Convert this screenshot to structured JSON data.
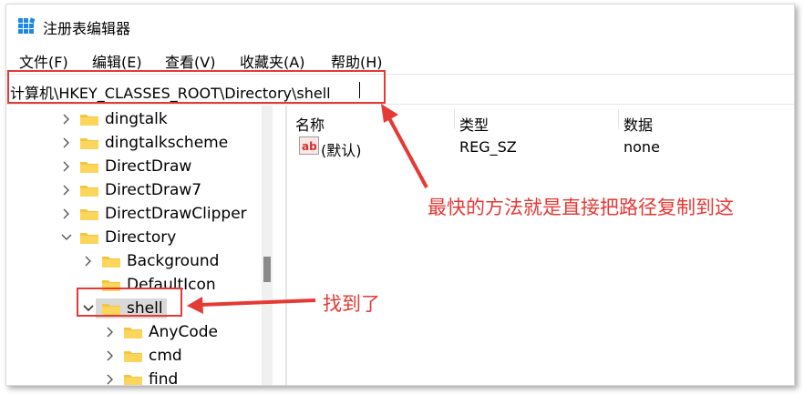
{
  "window": {
    "title": "注册表编辑器",
    "icon": "regedit-icon"
  },
  "menu": [
    "文件(F)",
    "编辑(E)",
    "查看(V)",
    "收藏夹(A)",
    "帮助(H)"
  ],
  "address": {
    "path": "计算机\\HKEY_CLASSES_ROOT\\Directory\\shell"
  },
  "tree": {
    "items": [
      {
        "label": "dingtalk",
        "expanded": false
      },
      {
        "label": "dingtalkscheme",
        "expanded": false
      },
      {
        "label": "DirectDraw",
        "expanded": false
      },
      {
        "label": "DirectDraw7",
        "expanded": false
      },
      {
        "label": "DirectDrawClipper",
        "expanded": false
      },
      {
        "label": "Directory",
        "expanded": true
      },
      {
        "label": "Background",
        "expanded": false
      },
      {
        "label": "DefaultIcon",
        "expanded": null
      },
      {
        "label": "shell",
        "expanded": true,
        "selected": true
      },
      {
        "label": "AnyCode",
        "expanded": false
      },
      {
        "label": "cmd",
        "expanded": false
      },
      {
        "label": "find",
        "expanded": false
      }
    ]
  },
  "list": {
    "columns": [
      "名称",
      "类型",
      "数据"
    ],
    "rows": [
      {
        "name": "(默认)",
        "type": "REG_SZ",
        "data": "none",
        "icon": "reg-string-icon"
      }
    ]
  },
  "annotations": {
    "address_note": "最快的方法就是直接把路径复制到这",
    "found_note": "找到了",
    "color": "#e53935"
  }
}
